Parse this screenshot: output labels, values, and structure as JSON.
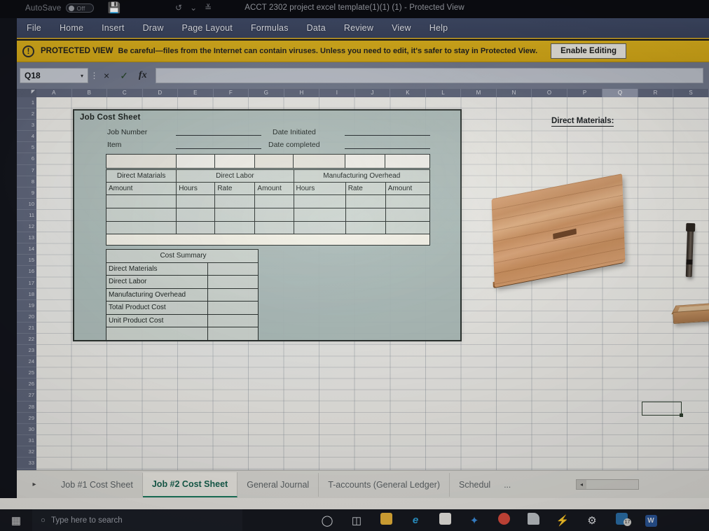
{
  "titlebar": {
    "autosave_label": "AutoSave",
    "autosave_state": "Off",
    "save_icon": "save-icon",
    "undo_icon": "undo-icon",
    "customize_icon": "customize-quick-access-icon",
    "document_title": "ACCT 2302 project excel template(1)(1) (1)  -  Protected View"
  },
  "ribbon": {
    "tabs": [
      {
        "label": "File"
      },
      {
        "label": "Home"
      },
      {
        "label": "Insert"
      },
      {
        "label": "Draw"
      },
      {
        "label": "Page Layout"
      },
      {
        "label": "Formulas"
      },
      {
        "label": "Data"
      },
      {
        "label": "Review"
      },
      {
        "label": "View"
      },
      {
        "label": "Help"
      }
    ]
  },
  "protected_view": {
    "icon": "shield-info-icon",
    "label": "PROTECTED VIEW",
    "message": "Be careful—files from the Internet can contain viruses. Unless you need to edit, it's safer to stay in Protected View.",
    "button": "Enable Editing",
    "bar_color": "#d8ae1c"
  },
  "formula_bar": {
    "name_box_value": "Q18",
    "name_box_caret": "▾",
    "cancel_icon": "×",
    "enter_icon": "✓",
    "function_icon": "fx",
    "formula_value": "",
    "formula_placeholder": ""
  },
  "grid": {
    "columns": [
      "A",
      "B",
      "C",
      "D",
      "E",
      "F",
      "G",
      "H",
      "I",
      "J",
      "K",
      "L",
      "M",
      "N",
      "O",
      "P",
      "Q",
      "R",
      "S"
    ],
    "selected_column": "Q",
    "rows": [
      1,
      2,
      3,
      4,
      5,
      6,
      7,
      8,
      9,
      10,
      11,
      12,
      13,
      14,
      15,
      16,
      17,
      18,
      19,
      20,
      21,
      22,
      23,
      24,
      25,
      26,
      27,
      28,
      29,
      30,
      31,
      32,
      33
    ],
    "selected_cell": "Q18"
  },
  "job_cost_sheet": {
    "title": "Job Cost Sheet",
    "header_fields": [
      {
        "label": "Job Number",
        "value": ""
      },
      {
        "label": "Date Initiated",
        "value": ""
      },
      {
        "label": "Item",
        "value": ""
      },
      {
        "label": "Date completed",
        "value": ""
      }
    ],
    "group_headers": [
      "Direct Matarials",
      "Direct Labor",
      "Manufacturing Overhead"
    ],
    "column_headers": [
      "Amount",
      "Hours",
      "Rate",
      "Amount",
      "Hours",
      "Rate",
      "Amount"
    ],
    "data_rows": [
      [
        "",
        "",
        "",
        "",
        "",
        "",
        ""
      ],
      [
        "",
        "",
        "",
        "",
        "",
        "",
        ""
      ],
      [
        "",
        "",
        "",
        "",
        "",
        "",
        ""
      ]
    ],
    "cost_summary": {
      "title": "Cost Summary",
      "rows": [
        {
          "label": "Direct Materials",
          "value": ""
        },
        {
          "label": "Direct Labor",
          "value": ""
        },
        {
          "label": "Manufacturing Overhead",
          "value": ""
        },
        {
          "label": "Total Product Cost",
          "value": ""
        },
        {
          "label": "Unit Product Cost",
          "value": ""
        },
        {
          "label": "",
          "value": ""
        }
      ]
    }
  },
  "materials_panel": {
    "title": "Direct Materials:",
    "items": [
      {
        "name": "wooden-cutting-board-image"
      },
      {
        "name": "dark-tool-handle-image"
      },
      {
        "name": "wooden-tray-box-image"
      }
    ]
  },
  "sheet_tabs": {
    "prev_icon": "▸",
    "tabs": [
      {
        "label": "Job #1 Cost Sheet",
        "active": false
      },
      {
        "label": "Job #2 Cost Sheet",
        "active": true
      },
      {
        "label": "General Journal",
        "active": false
      },
      {
        "label": "T-accounts (General Ledger)",
        "active": false
      },
      {
        "label": "Schedul",
        "active": false
      }
    ],
    "overflow": "...",
    "scroll_arrow": "◂",
    "active_tab_color": "#1b7a5e"
  },
  "taskbar": {
    "start_icon": "windows-start-icon",
    "search_icon": "○",
    "search_placeholder": "Type here to search",
    "icons": [
      {
        "name": "cortana-icon",
        "glyph": "○",
        "color": "#e3e6ea"
      },
      {
        "name": "task-view-icon",
        "glyph": "⌸",
        "color": "#d8dbe0"
      },
      {
        "name": "file-explorer-icon",
        "glyph": "",
        "color": "#e8b339"
      },
      {
        "name": "microsoft-edge-icon",
        "glyph": "e",
        "color": "#2ea3dd"
      },
      {
        "name": "microsoft-store-icon",
        "glyph": "",
        "color": "#e9e7e2"
      },
      {
        "name": "dropbox-icon",
        "glyph": "",
        "color": "#3b8fe0"
      },
      {
        "name": "google-chrome-icon",
        "glyph": "",
        "color": "#d94a3d"
      },
      {
        "name": "book-app-icon",
        "glyph": "",
        "color": "#bfc3c8"
      },
      {
        "name": "lightning-app-icon",
        "glyph": "⚡",
        "color": "#2fb7c9"
      },
      {
        "name": "settings-gear-icon",
        "glyph": "⚙",
        "color": "#e4e6ea"
      },
      {
        "name": "mail-icon",
        "glyph": "",
        "color": "#2a6fa8",
        "badge": "17"
      },
      {
        "name": "microsoft-word-icon",
        "glyph": "W",
        "color": "#2a5699"
      }
    ]
  }
}
